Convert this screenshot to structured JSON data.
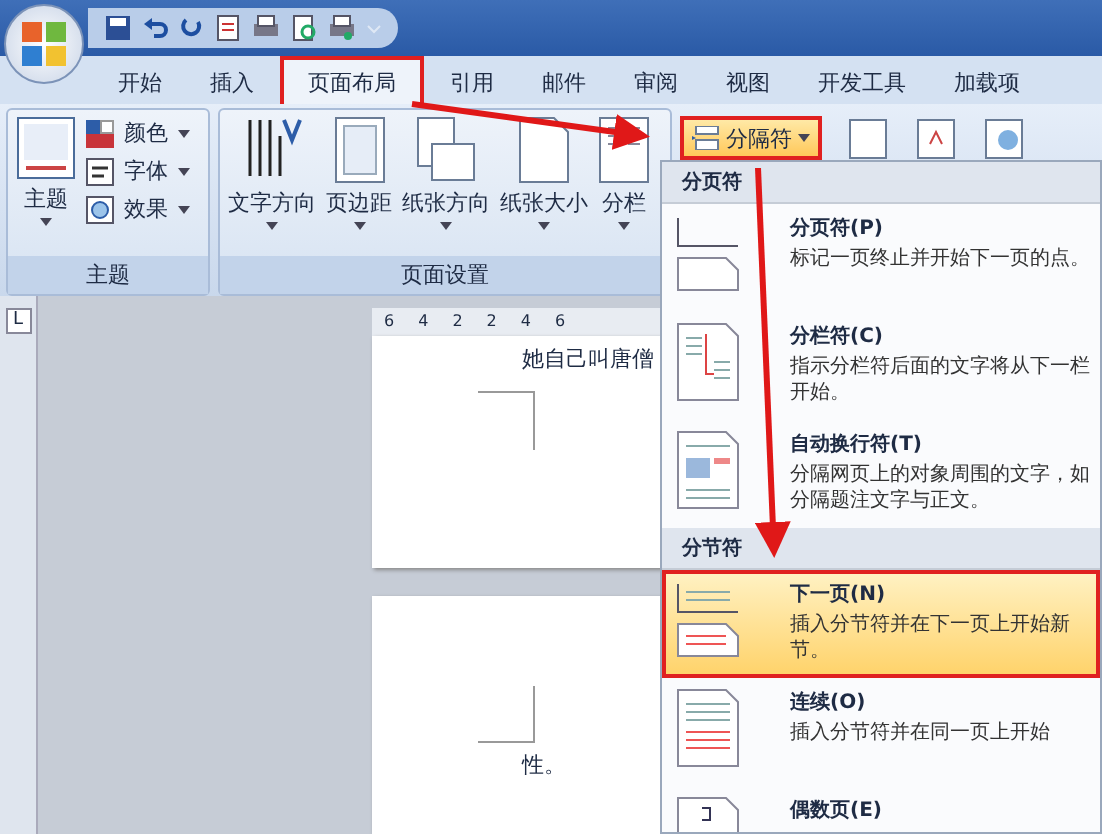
{
  "tabs": [
    {
      "label": "开始",
      "selected": false
    },
    {
      "label": "插入",
      "selected": false
    },
    {
      "label": "页面布局",
      "selected": true
    },
    {
      "label": "引用",
      "selected": false
    },
    {
      "label": "邮件",
      "selected": false
    },
    {
      "label": "审阅",
      "selected": false
    },
    {
      "label": "视图",
      "selected": false
    },
    {
      "label": "开发工具",
      "selected": false
    },
    {
      "label": "加载项",
      "selected": false
    }
  ],
  "ribbon_groups": [
    {
      "label": "主题",
      "big": [
        {
          "label": "主题"
        }
      ],
      "small": [
        {
          "label": "颜色"
        },
        {
          "label": "字体"
        },
        {
          "label": "效果"
        }
      ]
    },
    {
      "label": "页面设置",
      "big": [
        {
          "label": "文字方向"
        },
        {
          "label": "页边距"
        },
        {
          "label": "纸张方向"
        },
        {
          "label": "纸张大小"
        },
        {
          "label": "分栏"
        }
      ],
      "small": [
        {
          "label": "分隔符",
          "active": true
        }
      ]
    }
  ],
  "tab_selector": "L",
  "ruler": [
    "6",
    "4",
    "2",
    "2",
    "4",
    "6"
  ],
  "pages": [
    {
      "lines": [
        "她自己叫唐僧"
      ]
    },
    {
      "lines": [
        "性。"
      ]
    }
  ],
  "menu": {
    "sections": [
      {
        "header": "分页符",
        "items": [
          {
            "title": "分页符(P)",
            "description": "标记一页终止并开始下一页的点。",
            "selected": false
          },
          {
            "title": "分栏符(C)",
            "description": "指示分栏符后面的文字将从下一栏开始。",
            "selected": false
          },
          {
            "title": "自动换行符(T)",
            "description": "分隔网页上的对象周围的文字，如分隔题注文字与正文。",
            "selected": false
          }
        ]
      },
      {
        "header": "分节符",
        "items": [
          {
            "title": "下一页(N)",
            "description": "插入分节符并在下一页上开始新节。",
            "selected": true
          },
          {
            "title": "连续(O)",
            "description": "插入分节符并在同一页上开始",
            "selected": false
          },
          {
            "title": "偶数页(E)",
            "selected": false
          }
        ]
      }
    ]
  }
}
